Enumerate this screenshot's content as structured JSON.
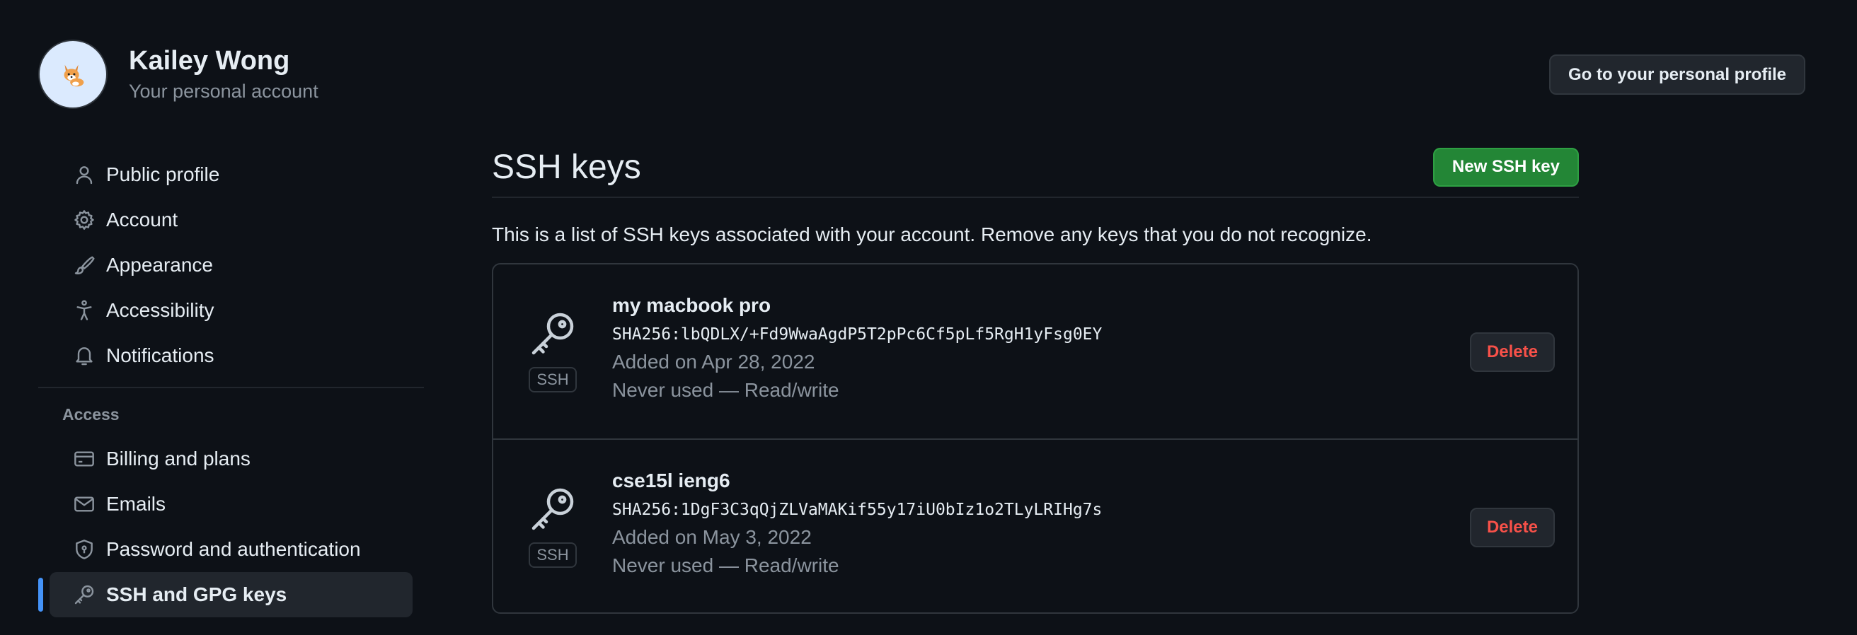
{
  "header": {
    "account_name": "Kailey Wong",
    "account_subtitle": "Your personal account",
    "avatar_icon": "corgi-avatar-icon",
    "profile_button_label": "Go to your personal profile"
  },
  "sidebar": {
    "items": [
      {
        "label": "Public profile",
        "icon": "person-icon"
      },
      {
        "label": "Account",
        "icon": "gear-icon"
      },
      {
        "label": "Appearance",
        "icon": "paintbrush-icon"
      },
      {
        "label": "Accessibility",
        "icon": "accessibility-icon"
      },
      {
        "label": "Notifications",
        "icon": "bell-icon"
      }
    ],
    "access_section_title": "Access",
    "access_items": [
      {
        "label": "Billing and plans",
        "icon": "credit-card-icon"
      },
      {
        "label": "Emails",
        "icon": "mail-icon"
      },
      {
        "label": "Password and authentication",
        "icon": "shield-lock-icon"
      },
      {
        "label": "SSH and GPG keys",
        "icon": "key-icon",
        "active": true
      }
    ]
  },
  "main": {
    "title": "SSH keys",
    "new_key_button": "New SSH key",
    "intro": "This is a list of SSH keys associated with your account. Remove any keys that you do not recognize.",
    "keys": [
      {
        "title": "my macbook pro",
        "fingerprint": "SHA256:lbQDLX/+Fd9WwaAgdP5T2pPc6Cf5pLf5RgH1yFsg0EY",
        "added": "Added on Apr 28, 2022",
        "usage": "Never used — Read/write",
        "badge": "SSH",
        "delete_label": "Delete"
      },
      {
        "title": "cse15l ieng6",
        "fingerprint": "SHA256:1DgF3C3qQjZLVaMAKif55y17iU0bIz1o2TLyLRIHg7s",
        "added": "Added on May 3, 2022",
        "usage": "Never used — Read/write",
        "badge": "SSH",
        "delete_label": "Delete"
      }
    ]
  },
  "colors": {
    "background": "#0d1117",
    "primary_button": "#238636",
    "danger_text": "#f85149",
    "active_indicator": "#4493f8"
  }
}
